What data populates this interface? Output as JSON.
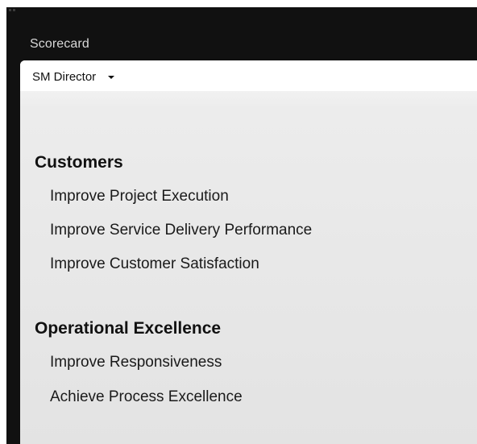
{
  "panel": {
    "title": "Scorecard"
  },
  "scorecard_selector": {
    "selected": "SM Director"
  },
  "sections": [
    {
      "title": "Customers",
      "objectives": [
        "Improve Project Execution",
        "Improve Service Delivery Performance",
        "Improve Customer Satisfaction"
      ]
    },
    {
      "title": "Operational Excellence",
      "objectives": [
        "Improve Responsiveness",
        "Achieve Process Excellence"
      ]
    }
  ],
  "icons": {
    "dropdown": "chevron-down-icon",
    "grip": "drag-grip-icon"
  }
}
